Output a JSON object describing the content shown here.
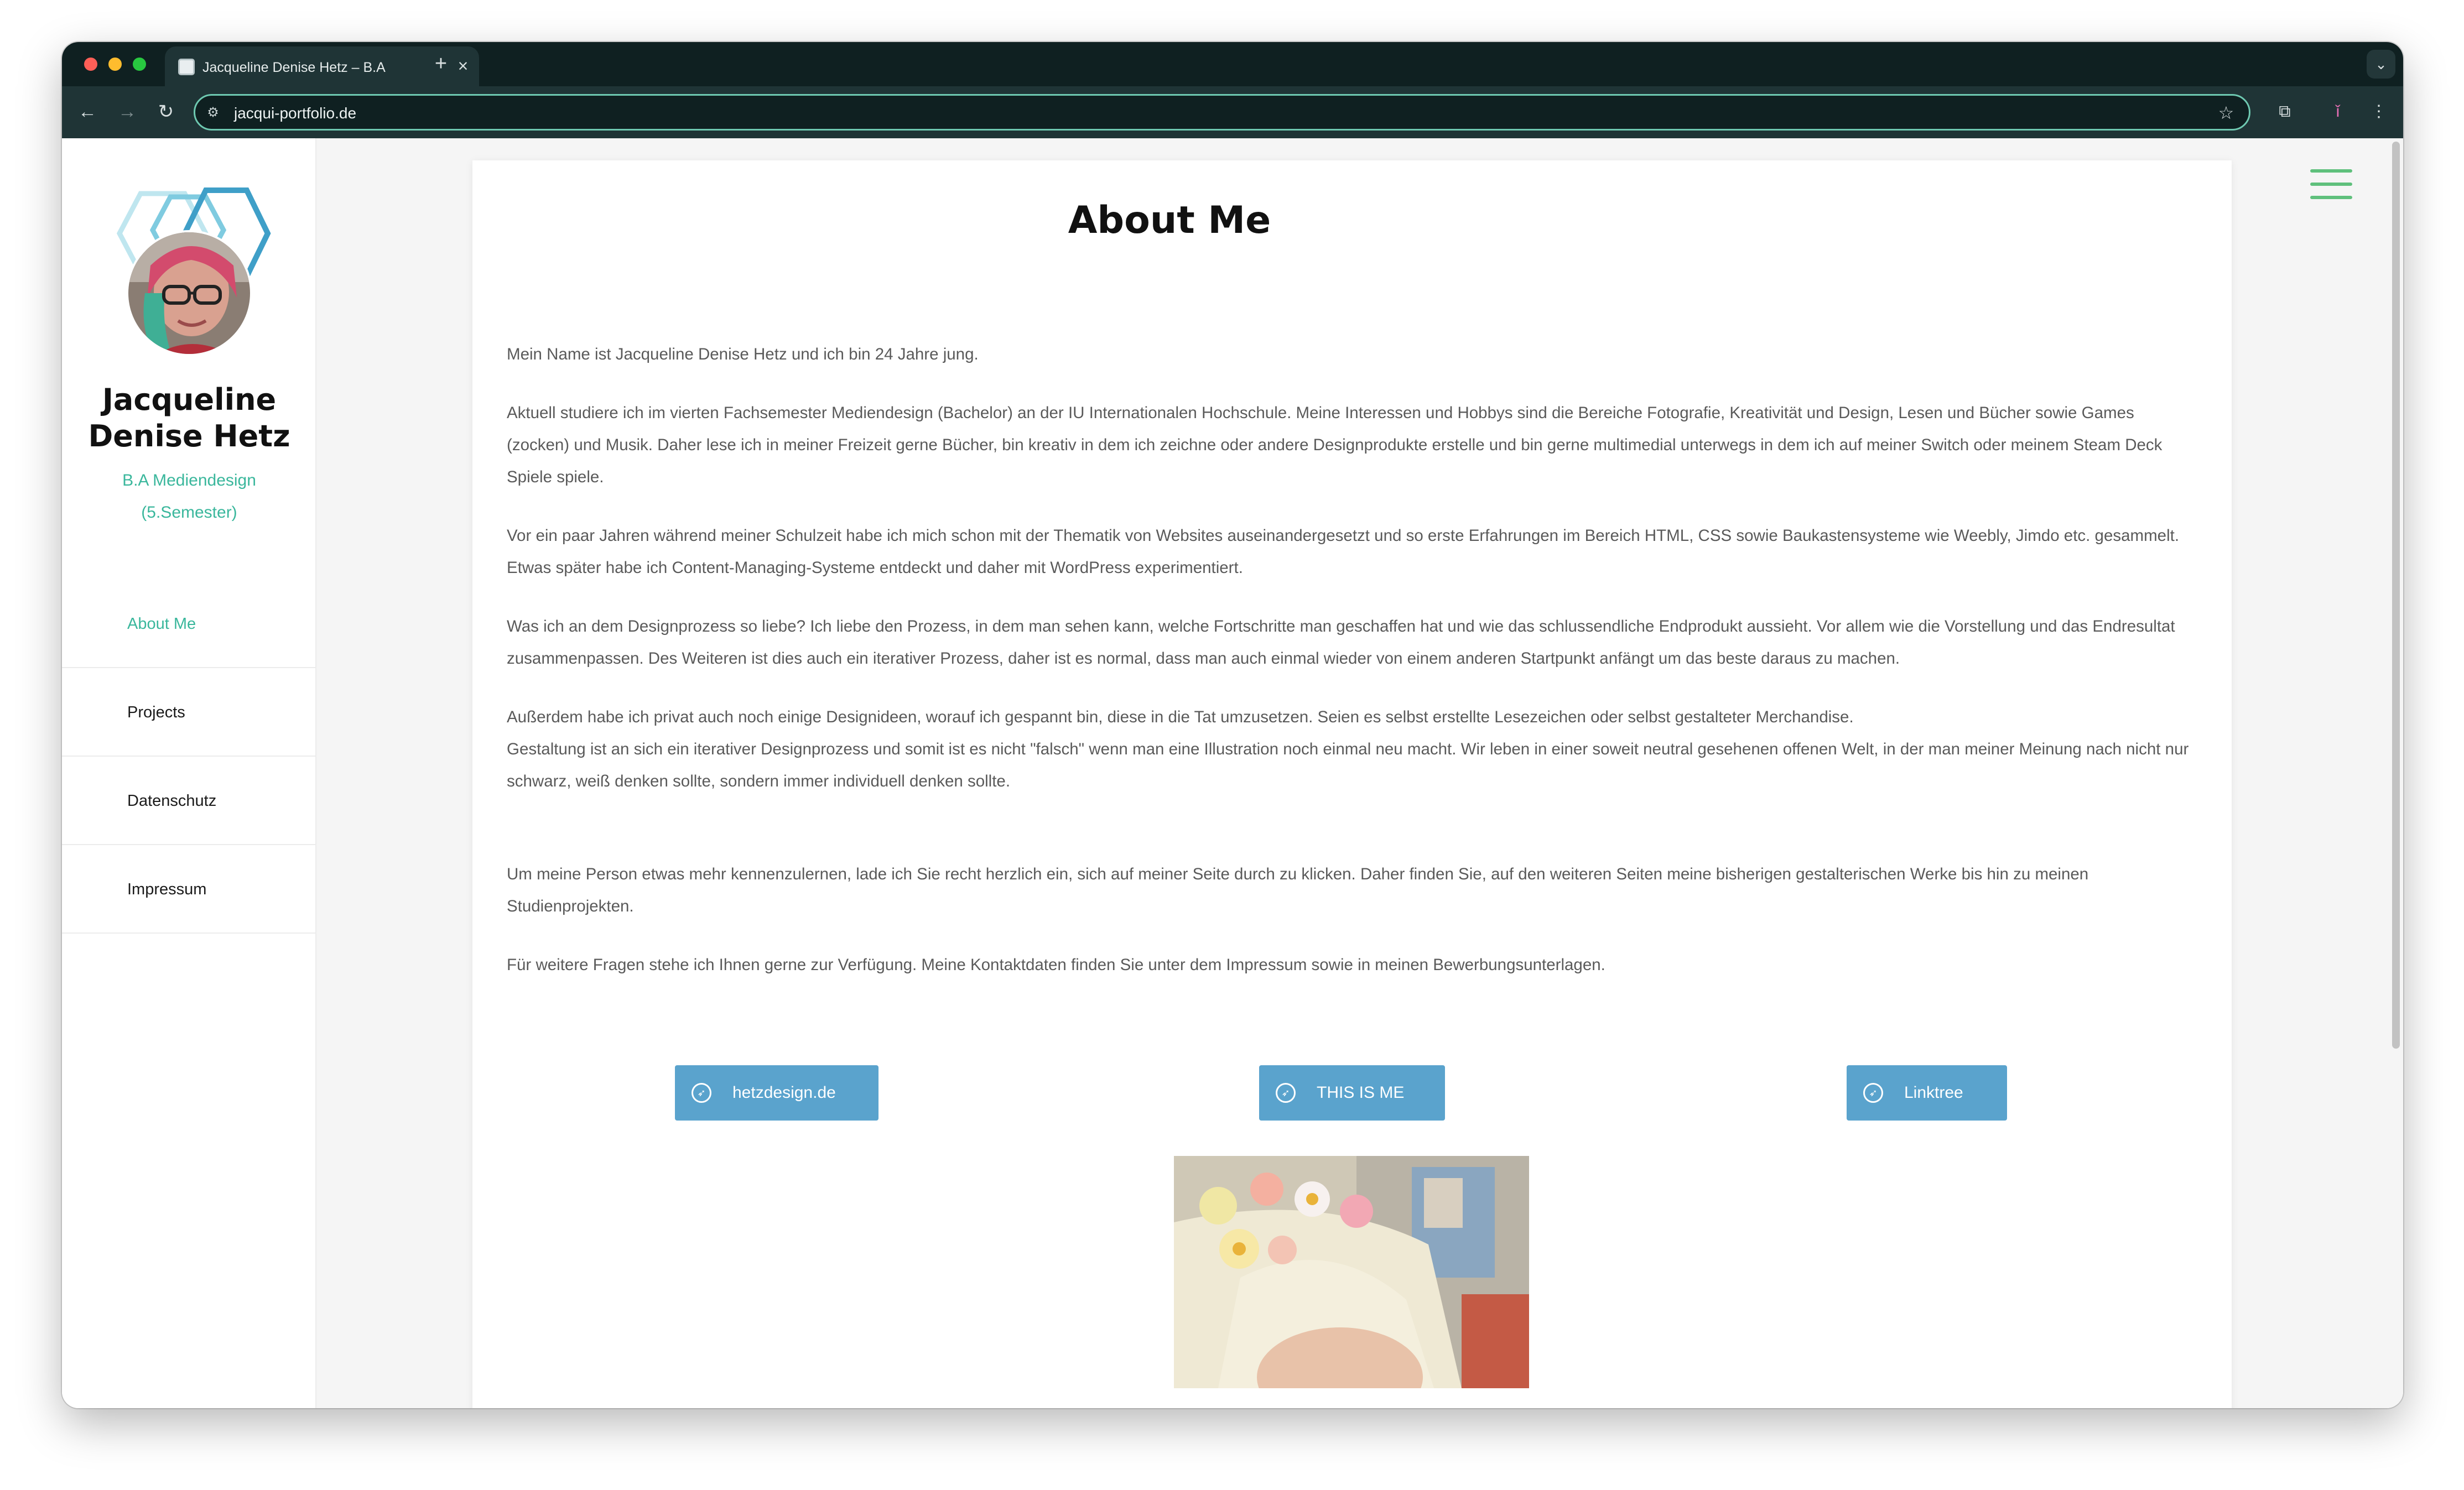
{
  "browser": {
    "tab_title": "Jacqueline Denise Hetz – B.A",
    "url": "jacqui-portfolio.de"
  },
  "icons": {
    "tab_close": "×",
    "new_tab": "+",
    "tab_search": "⌄",
    "back": "←",
    "forward": "→",
    "reload": "↻",
    "site_info": "⚙",
    "bookmark": "☆",
    "extensions": "⧉",
    "profile": "ǐ",
    "menu": "⋮",
    "compass": "➶"
  },
  "sidebar": {
    "name": "Jacqueline Denise Hetz",
    "subtitle_line1": "B.A Mediendesign",
    "subtitle_line2": "(5.Semester)",
    "nav": [
      {
        "label": "About Me",
        "active": true
      },
      {
        "label": "Projects",
        "active": false
      },
      {
        "label": "Datenschutz",
        "active": false
      },
      {
        "label": "Impressum",
        "active": false
      }
    ]
  },
  "main": {
    "title": "About Me",
    "paragraphs": [
      "Mein Name ist Jacqueline Denise Hetz und ich bin 24 Jahre jung.",
      "Aktuell studiere ich im vierten Fachsemester Mediendesign (Bachelor) an der IU Internationalen Hochschule. Meine Interessen und Hobbys sind die Bereiche Fotografie, Kreativität und Design, Lesen und Bücher sowie Games (zocken) und Musik. Daher lese ich in meiner Freizeit gerne Bücher, bin kreativ in dem ich zeichne oder andere Designprodukte erstelle und bin gerne multimedial unterwegs in dem ich auf meiner Switch oder meinem Steam Deck Spiele spiele.",
      "Vor ein paar Jahren während meiner Schulzeit habe ich mich schon mit der Thematik von Websites auseinandergesetzt und so erste Erfahrungen im Bereich HTML, CSS  sowie Baukastensysteme wie Weebly, Jimdo etc. gesammelt. Etwas später habe ich Content-Managing-Systeme entdeckt und daher mit WordPress experimentiert.",
      "Was ich an dem Designprozess so liebe? Ich liebe den Prozess, in dem man sehen kann, welche Fortschritte man geschaffen hat und wie das schlussendliche Endprodukt aussieht. Vor allem wie die Vorstellung und das Endresultat zusammenpassen. Des Weiteren ist dies auch ein iterativer Prozess, daher ist es normal, dass man auch einmal wieder von einem anderen Startpunkt anfängt um das beste daraus zu machen.",
      "Außerdem habe ich privat auch noch einige Designideen, worauf ich gespannt bin, diese in die Tat umzusetzen. Seien es selbst erstellte Lesezeichen oder selbst gestalteter Merchandise.",
      "Gestaltung ist an sich ein iterativer Designprozess und somit ist es nicht \"falsch\" wenn man eine Illustration noch einmal neu macht. Wir leben in einer soweit neutral gesehenen offenen Welt, in der man meiner Meinung nach nicht nur schwarz, weiß denken sollte, sondern immer individuell denken sollte.",
      "Um meine Person etwas mehr kennenzulernen, lade ich Sie recht herzlich ein, sich auf meiner Seite durch zu klicken. Daher finden Sie, auf den weiteren Seiten meine bisherigen gestalterischen Werke bis hin zu meinen Studienprojekten.",
      "Für weitere Fragen stehe ich Ihnen gerne zur Verfügung. Meine Kontaktdaten finden Sie unter dem Impressum sowie in meinen Bewerbungsunterlagen."
    ],
    "buttons": [
      {
        "label": "hetzdesign.de"
      },
      {
        "label": "THIS IS ME"
      },
      {
        "label": "Linktree"
      }
    ]
  },
  "colors": {
    "accent_green": "#3ab79c",
    "hamburger_green": "#5fc07c",
    "button_blue": "#5aa3cd",
    "browser_dark": "#0f2021"
  }
}
